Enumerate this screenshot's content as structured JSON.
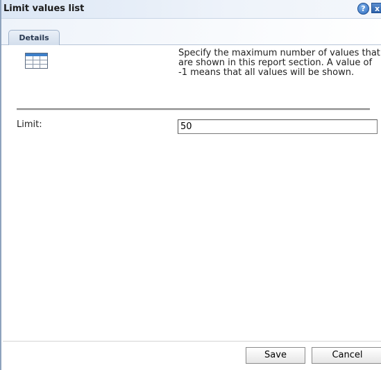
{
  "dialog": {
    "title": "Limit values list",
    "help_glyph": "?",
    "close_glyph": "x",
    "icons": {
      "help": "help-icon",
      "close": "close-icon",
      "section": "table-icon"
    }
  },
  "tabs": [
    {
      "label": "Details",
      "selected": true
    }
  ],
  "details": {
    "description": "Specify the maximum number of values that are shown in this report section. A value of -1 means that all values will be shown.",
    "limit_label": "Limit:",
    "limit_value": "50"
  },
  "buttons": {
    "save": "Save",
    "cancel": "Cancel"
  },
  "colors": {
    "help_icon": "#2e6bbf",
    "close_icon": "#2d62ab",
    "title_bar": "#dce7f5",
    "tab_border": "#9fb2ca"
  }
}
